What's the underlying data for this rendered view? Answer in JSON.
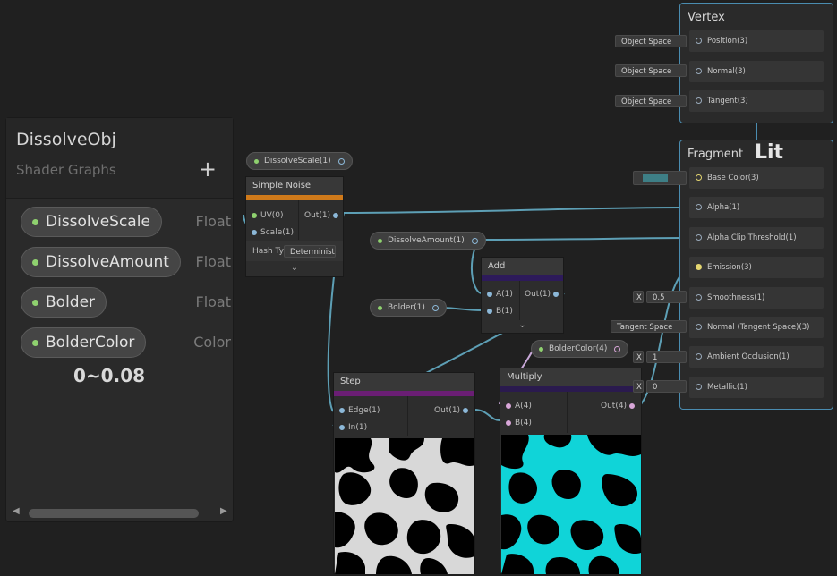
{
  "blackboard": {
    "title": "DissolveObj",
    "subtitle": "Shader Graphs",
    "add_label": "+",
    "properties": [
      {
        "name": "DissolveScale",
        "type": "Float"
      },
      {
        "name": "DissolveAmount",
        "type": "Float"
      },
      {
        "name": "Bolder",
        "type": "Float"
      },
      {
        "name": "BolderColor",
        "type": "Color"
      }
    ],
    "note": "0~0.08",
    "scroll_left": "◀",
    "scroll_right": "▶"
  },
  "property_nodes": {
    "dissolve_scale": "DissolveScale(1)",
    "dissolve_amount": "DissolveAmount(1)",
    "bolder": "Bolder(1)",
    "bolder_color": "BolderColor(4)"
  },
  "simple_noise": {
    "title": "Simple Noise",
    "bar_color": "#d07a1a",
    "inputs": [
      "UV(0)",
      "Scale(1)"
    ],
    "output": "Out(1)",
    "hash_label": "Hash Ty",
    "hash_value": "Deterministic",
    "expand": "⌄"
  },
  "add_node": {
    "title": "Add",
    "bar_color": "#2d1a5a",
    "inputs": [
      "A(1)",
      "B(1)"
    ],
    "output": "Out(1)",
    "expand": "⌄"
  },
  "step_node": {
    "title": "Step",
    "bar_color": "#6a1e74",
    "inputs": [
      "Edge(1)",
      "In(1)"
    ],
    "output": "Out(1)"
  },
  "multiply_node": {
    "title": "Multiply",
    "bar_color": "#2a1a4e",
    "inputs": [
      "A(4)",
      "B(4)"
    ],
    "output": "Out(4)"
  },
  "vertex": {
    "title": "Vertex",
    "slots": [
      {
        "label": "Position(3)",
        "space": "Object Space"
      },
      {
        "label": "Normal(3)",
        "space": "Object Space"
      },
      {
        "label": "Tangent(3)",
        "space": "Object Space"
      }
    ]
  },
  "fragment": {
    "title": "Fragment",
    "lit_label": "Lit",
    "base_color_swatch": "#3e7f86",
    "slots": [
      {
        "label": "Base Color(3)"
      },
      {
        "label": "Alpha(1)"
      },
      {
        "label": "Alpha Clip Threshold(1)"
      },
      {
        "label": "Emission(3)"
      },
      {
        "label": "Smoothness(1)",
        "x": "X",
        "value": "0.5"
      },
      {
        "label": "Normal (Tangent Space)(3)",
        "space": "Tangent Space"
      },
      {
        "label": "Ambient Occlusion(1)",
        "x": "X",
        "value": "1"
      },
      {
        "label": "Metallic(1)",
        "x": "X",
        "value": "0"
      }
    ]
  },
  "colors": {
    "wire_float": "#5d9fb5",
    "preview_cyan": "#10d4d8",
    "master_border": "#4a8cb0"
  }
}
